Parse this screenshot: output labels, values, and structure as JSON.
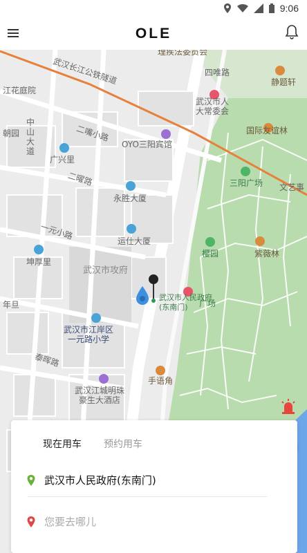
{
  "status_bar": {
    "time": "9:06"
  },
  "header": {
    "brand": "OLE"
  },
  "map": {
    "labels": [
      {
        "key": "road_rail",
        "text": "武汉长江公铁隧道"
      },
      {
        "key": "committee",
        "text": "理疾法委员会"
      },
      {
        "key": "sinan",
        "text": "四唯路"
      },
      {
        "key": "jinghan",
        "text": "静题轩"
      },
      {
        "key": "jianghua",
        "text": "江花庭院"
      },
      {
        "key": "npc",
        "text": "武汉市人\n大常委会"
      },
      {
        "key": "national_tower",
        "text": "国际友谊林"
      },
      {
        "key": "yuan",
        "text": "朝园"
      },
      {
        "key": "zhongshan",
        "text": "中山大道"
      },
      {
        "key": "erchang",
        "text": "二嘴小路"
      },
      {
        "key": "oyo",
        "text": "OYO三阳宾馆"
      },
      {
        "key": "guangxing",
        "text": "广兴里"
      },
      {
        "key": "sanyang",
        "text": "三阳广场"
      },
      {
        "key": "wenyi",
        "text": "文艺事"
      },
      {
        "key": "erdao",
        "text": "二曜路"
      },
      {
        "key": "yongsheng",
        "text": "永胜大厦"
      },
      {
        "key": "yiyuan",
        "text": "一元小路"
      },
      {
        "key": "yunshi",
        "text": "运仕大厦"
      },
      {
        "key": "yingyuan",
        "text": "樱园"
      },
      {
        "key": "ziwei",
        "text": "紫薇林"
      },
      {
        "key": "kunhou",
        "text": "坤厚里"
      },
      {
        "key": "gov",
        "text": "武汉市攻府"
      },
      {
        "key": "nianli",
        "text": "年旦"
      },
      {
        "key": "gov_se",
        "text": "武汉市人民政府\n(东南门)"
      },
      {
        "key": "plaza",
        "text": "广场"
      },
      {
        "key": "school",
        "text": "武汉市江岸区\n一元路小学"
      },
      {
        "key": "taijing",
        "text": "泰晖路"
      },
      {
        "key": "shouyu",
        "text": "手语角"
      },
      {
        "key": "mingzhu",
        "text": "武汉江城明珠\n豪生大酒店"
      }
    ]
  },
  "ride_panel": {
    "tabs": {
      "now": "现在用车",
      "book": "预约用车"
    },
    "from": "武汉市人民政府(东南门)",
    "to_placeholder": "您要去哪儿"
  }
}
